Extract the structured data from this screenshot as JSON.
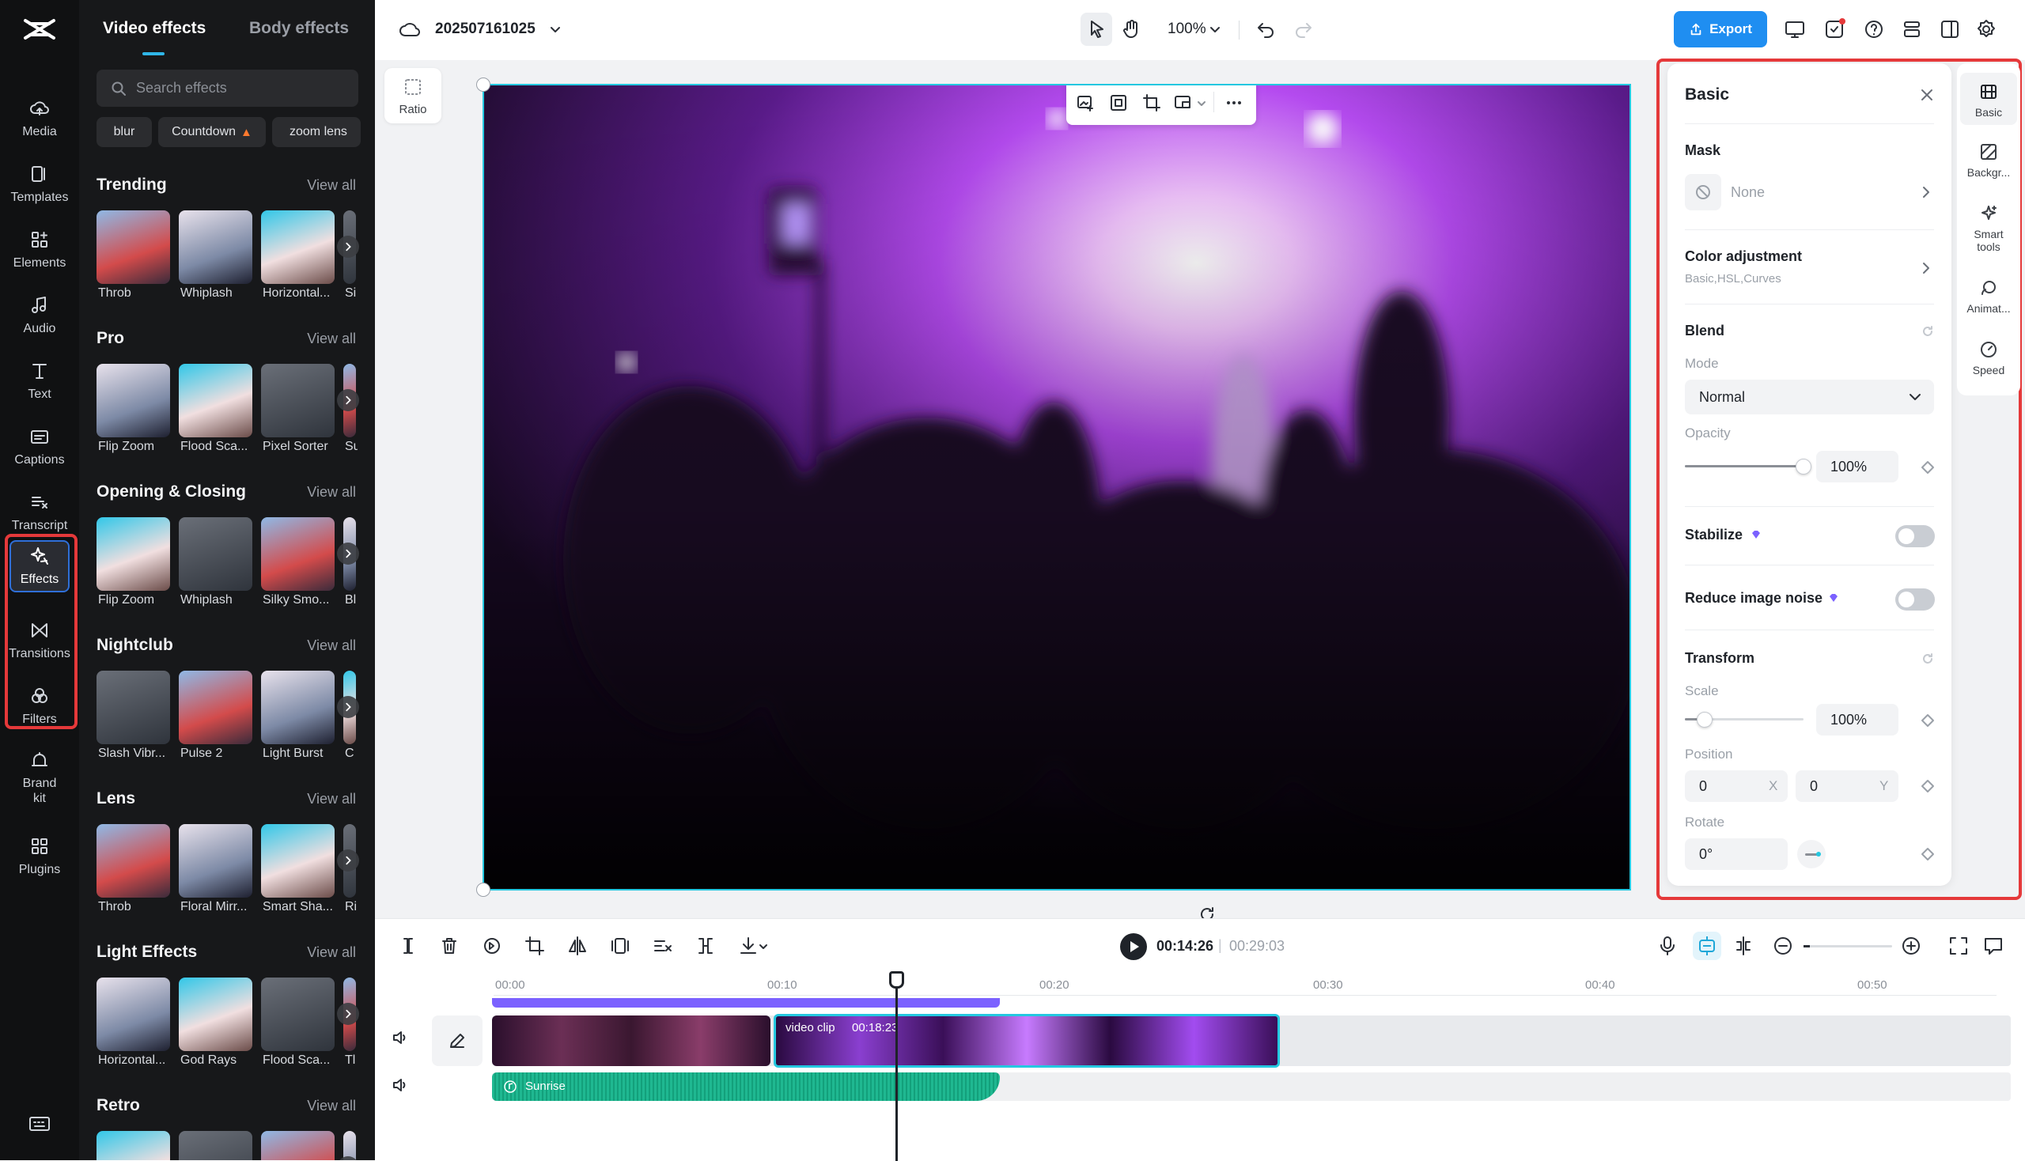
{
  "rail": {
    "items": [
      {
        "label": "Media"
      },
      {
        "label": "Templates"
      },
      {
        "label": "Elements"
      },
      {
        "label": "Audio"
      },
      {
        "label": "Text"
      },
      {
        "label": "Captions"
      },
      {
        "label": "Transcript"
      },
      {
        "label": "Effects"
      },
      {
        "label": "Transitions"
      },
      {
        "label": "Filters"
      },
      {
        "label": "Brand kit"
      },
      {
        "label": "Plugins"
      }
    ]
  },
  "effects_panel": {
    "tabs": [
      "Video effects",
      "Body effects"
    ],
    "search_placeholder": "Search effects",
    "chips": [
      "blur",
      "Countdown",
      "zoom lens"
    ],
    "view_all": "View all",
    "sections": [
      {
        "title": "Trending",
        "items": [
          "Throb",
          "Whiplash",
          "Horizontal...",
          "Si"
        ]
      },
      {
        "title": "Pro",
        "items": [
          "Flip Zoom",
          "Flood Sca...",
          "Pixel Sorter",
          "Su"
        ]
      },
      {
        "title": "Opening & Closing",
        "items": [
          "Flip Zoom",
          "Whiplash",
          "Silky Smo...",
          "Bl"
        ]
      },
      {
        "title": "Nightclub",
        "items": [
          "Slash Vibr...",
          "Pulse 2",
          "Light Burst",
          "C"
        ]
      },
      {
        "title": "Lens",
        "items": [
          "Throb",
          "Floral Mirr...",
          "Smart Sha...",
          "Ri"
        ]
      },
      {
        "title": "Light Effects",
        "items": [
          "Horizontal...",
          "God Rays",
          "Flood Sca...",
          "Tl"
        ]
      },
      {
        "title": "Retro",
        "items": [
          "",
          "",
          "",
          ""
        ]
      }
    ]
  },
  "topbar": {
    "project_name": "202507161025",
    "zoom": "100%",
    "export_label": "Export"
  },
  "canvas": {
    "ratio_label": "Ratio"
  },
  "basic_panel": {
    "title": "Basic",
    "mask": {
      "label": "Mask",
      "value": "None"
    },
    "color_adjustment": {
      "label": "Color adjustment",
      "sub": "Basic,HSL,Curves"
    },
    "blend": {
      "label": "Blend",
      "mode_label": "Mode",
      "mode_value": "Normal",
      "opacity_label": "Opacity",
      "opacity_value": "100%",
      "opacity_level": 1.0
    },
    "stabilize": {
      "label": "Stabilize",
      "on": false
    },
    "reduce_noise": {
      "label": "Reduce image noise",
      "on": false
    },
    "transform": {
      "label": "Transform",
      "scale_label": "Scale",
      "scale_value": "100%",
      "scale_level": 0.1,
      "position_label": "Position",
      "pos_x": "0",
      "pos_x_axis": "X",
      "pos_y": "0",
      "pos_y_axis": "Y",
      "rotate_label": "Rotate",
      "rotate_value": "0°"
    }
  },
  "right_sidebar": {
    "items": [
      "Basic",
      "Backgr...",
      "Smart tools",
      "Animat...",
      "Speed"
    ]
  },
  "timeline": {
    "current_time": "00:14:26",
    "separator": "|",
    "total_time": "00:29:03",
    "ruler": [
      "00:00",
      "00:10",
      "00:20",
      "00:30",
      "00:40",
      "00:50"
    ],
    "clip_label": "video clip",
    "clip_duration": "00:18:23",
    "audio_label": "Sunrise"
  },
  "colors": {
    "accent": "#1f8ef1",
    "highlight_red": "#e5393a",
    "selection_cyan": "#24c8e0",
    "audio_green": "#1fb891",
    "purple_bar": "#7b61ff"
  }
}
